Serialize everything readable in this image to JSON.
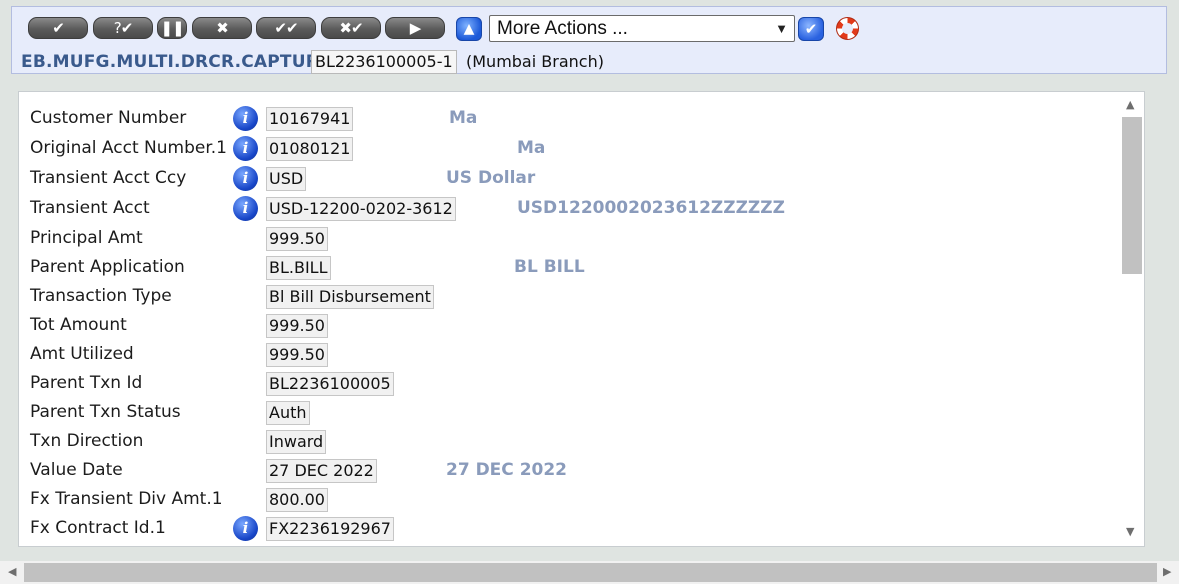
{
  "toolbar": {
    "buttons": [
      {
        "label": "✔",
        "name": "commit-button"
      },
      {
        "label": "?✔",
        "name": "validate-button"
      },
      {
        "label": "❚❚",
        "name": "hold-button"
      },
      {
        "label": "✖",
        "name": "delete-button"
      },
      {
        "label": "✔✔",
        "name": "authorise-button"
      },
      {
        "label": "✖✔",
        "name": "reverse-button"
      },
      {
        "label": "▶",
        "name": "next-button"
      }
    ],
    "up_icon": "up-arrow-icon",
    "more_actions_value": "More Actions ...",
    "go_icon": "checkmark-icon",
    "help_icon": "lifebuoy-icon"
  },
  "header": {
    "app_name": "EB.MUFG.MULTI.DRCR.CAPTURE",
    "transaction_id": "BL2236100005-1",
    "branch": "(Mumbai Branch)"
  },
  "fields": [
    {
      "label": "Customer Number",
      "info": true,
      "value": "10167941",
      "enrichment": "Ma"
    },
    {
      "label": "Original Acct Number.1",
      "info": true,
      "value": "01080121",
      "enrichment": "Ma"
    },
    {
      "label": "Transient Acct Ccy",
      "info": true,
      "value": "USD",
      "enrichment": "US Dollar"
    },
    {
      "label": "Transient Acct",
      "info": true,
      "value": "USD-12200-0202-3612",
      "enrichment": "USD1220002023612ZZZZZZ"
    },
    {
      "label": "Principal Amt",
      "info": false,
      "value": "999.50",
      "enrichment": ""
    },
    {
      "label": "Parent Application",
      "info": false,
      "value": "BL.BILL",
      "enrichment": "BL BILL"
    },
    {
      "label": "Transaction Type",
      "info": false,
      "value": "Bl Bill Disbursement",
      "enrichment": ""
    },
    {
      "label": "Tot Amount",
      "info": false,
      "value": "999.50",
      "enrichment": ""
    },
    {
      "label": "Amt Utilized",
      "info": false,
      "value": "999.50",
      "enrichment": ""
    },
    {
      "label": "Parent Txn Id",
      "info": false,
      "value": "BL2236100005",
      "enrichment": ""
    },
    {
      "label": "Parent Txn Status",
      "info": false,
      "value": "Auth",
      "enrichment": ""
    },
    {
      "label": "Txn Direction",
      "info": false,
      "value": "Inward",
      "enrichment": ""
    },
    {
      "label": "Value Date",
      "info": false,
      "value": "27 DEC 2022",
      "enrichment": "27 DEC 2022"
    },
    {
      "label": "Fx Transient Div Amt.1",
      "info": false,
      "value": "800.00",
      "enrichment": ""
    },
    {
      "label": "Fx Contract Id.1",
      "info": true,
      "value": "FX2236192967",
      "enrichment": ""
    }
  ],
  "colors": {
    "header_bg": "#e7ecfb",
    "app_name": "#3a5a8c",
    "enrichment_text": "#8a9bbb",
    "info_icon": "#1846c8"
  }
}
